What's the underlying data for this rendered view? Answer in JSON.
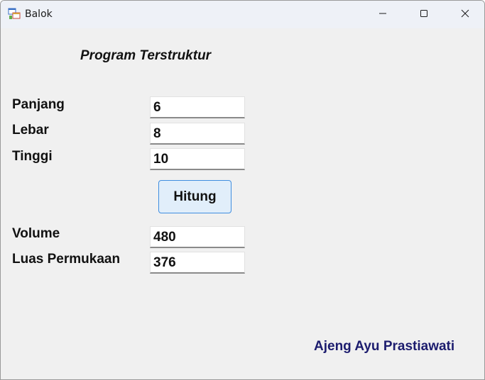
{
  "window": {
    "title": "Balok",
    "icon": "winforms-app-icon"
  },
  "titlebar_buttons": {
    "minimize": "minimize-icon",
    "maximize": "maximize-icon",
    "close": "close-icon"
  },
  "form": {
    "heading": "Program Terstruktur",
    "fields": {
      "panjang": {
        "label": "Panjang",
        "value": "6"
      },
      "lebar": {
        "label": "Lebar",
        "value": "8"
      },
      "tinggi": {
        "label": "Tinggi",
        "value": "10"
      }
    },
    "button_label": "Hitung",
    "results": {
      "volume": {
        "label": "Volume",
        "value": "480"
      },
      "luas": {
        "label": "Luas Permukaan",
        "value": "376"
      }
    },
    "author": "Ajeng Ayu Prastiawati"
  },
  "colors": {
    "form_background": "#f0f0f0",
    "button_background": "#e1eefa",
    "button_border": "#3f8ee0",
    "author_text": "#1c1c6e"
  }
}
